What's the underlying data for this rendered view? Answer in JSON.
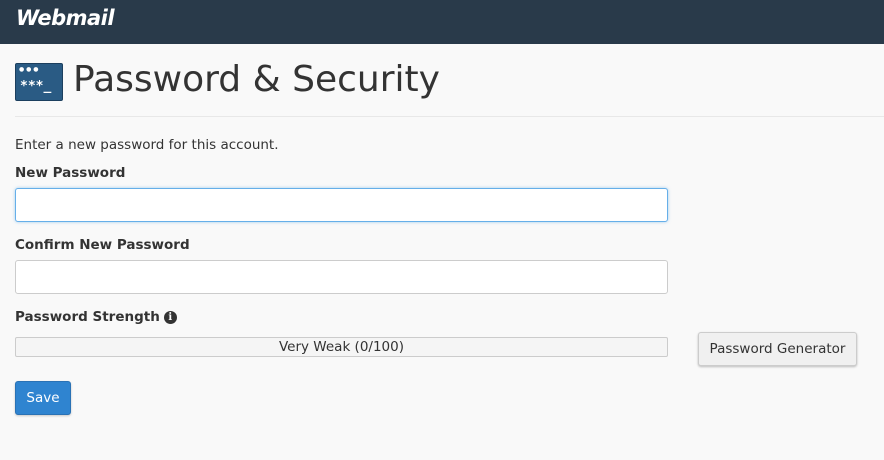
{
  "header": {
    "logo_text": "Webmail",
    "background": "#293a4a"
  },
  "page": {
    "title": "Password & Security",
    "icon": "password-terminal-icon"
  },
  "form": {
    "intro": "Enter a new password for this account.",
    "new_password": {
      "label": "New Password",
      "value": "",
      "placeholder": ""
    },
    "confirm_password": {
      "label": "Confirm New Password",
      "value": "",
      "placeholder": ""
    },
    "strength": {
      "label": "Password Strength",
      "info_icon": "info-circle-icon",
      "text": "Very Weak (0/100)",
      "score": 0
    },
    "generator_button": "Password Generator",
    "save_button": "Save"
  },
  "colors": {
    "accent": "#2f84d0",
    "focus": "#66afe9"
  }
}
